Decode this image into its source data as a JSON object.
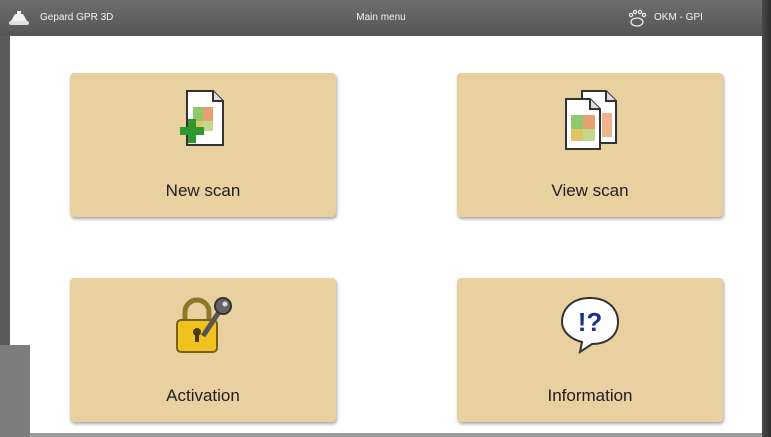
{
  "titlebar": {
    "app_title": "Gepard GPR 3D",
    "menu_title": "Main menu",
    "brand": "OKM - GPI",
    "app_icon": "gpr-device-icon",
    "brand_icon": "okm-logo-icon"
  },
  "tiles": [
    {
      "label": "New scan",
      "icon": "new-scan-icon"
    },
    {
      "label": "View scan",
      "icon": "view-scan-icon"
    },
    {
      "label": "Activation",
      "icon": "padlock-key-icon"
    },
    {
      "label": "Information",
      "icon": "information-bubble-icon"
    }
  ],
  "colors": {
    "tile_background": "#e8d0a0",
    "titlebar": "#5e5e5e",
    "content_background": "#ffffff",
    "plus_green": "#2e9a2e",
    "lock_yellow": "#f0c21e",
    "info_blue": "#1a2f8a"
  }
}
